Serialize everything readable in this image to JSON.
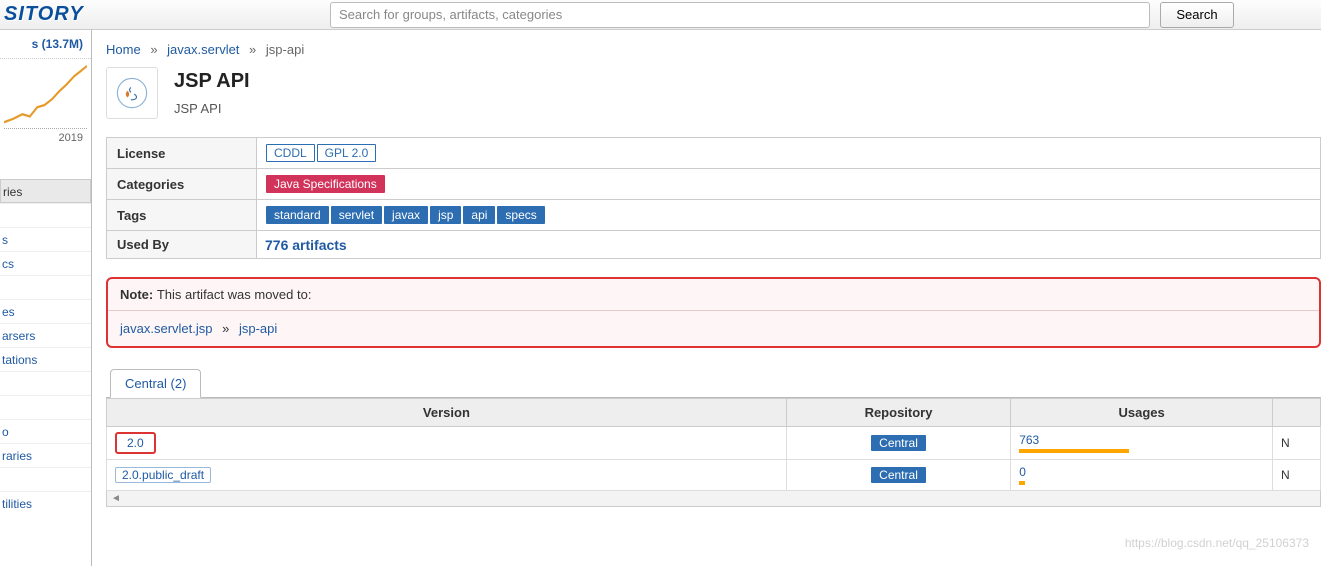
{
  "topbar": {
    "logo_fragment": "SITORY",
    "search_placeholder": "Search for groups, artifacts, categories",
    "search_button": "Search"
  },
  "sidebar": {
    "stats_text": "s (13.7M)",
    "spark_year": "2019",
    "items": [
      "ries",
      "",
      "s",
      "cs",
      "",
      "es",
      "arsers",
      "tations",
      "",
      "",
      "o",
      "raries",
      "",
      "tilities"
    ],
    "active_index": 0
  },
  "breadcrumb": {
    "home": "Home",
    "group": "javax.servlet",
    "artifact": "jsp-api"
  },
  "artifact": {
    "title": "JSP API",
    "subtitle": "JSP API"
  },
  "meta": {
    "labels": {
      "license": "License",
      "categories": "Categories",
      "tags": "Tags",
      "used_by": "Used By"
    },
    "licenses": [
      "CDDL",
      "GPL 2.0"
    ],
    "categories": [
      "Java Specifications"
    ],
    "tags": [
      "standard",
      "servlet",
      "javax",
      "jsp",
      "api",
      "specs"
    ],
    "used_by": "776 artifacts"
  },
  "notice": {
    "label": "Note",
    "text": "This artifact was moved to:",
    "target_group": "javax.servlet.jsp",
    "target_artifact": "jsp-api"
  },
  "tabs": {
    "central": "Central (2)"
  },
  "versions": {
    "headers": {
      "version": "Version",
      "repository": "Repository",
      "usages": "Usages"
    },
    "rows": [
      {
        "version": "2.0",
        "repo": "Central",
        "usages": "763",
        "bar_pct": 100,
        "highlight": true,
        "trail": "N"
      },
      {
        "version": "2.0.public_draft",
        "repo": "Central",
        "usages": "0",
        "bar_pct": 5,
        "highlight": false,
        "trail": "N"
      }
    ]
  },
  "watermark": "https://blog.csdn.net/qq_25106373"
}
